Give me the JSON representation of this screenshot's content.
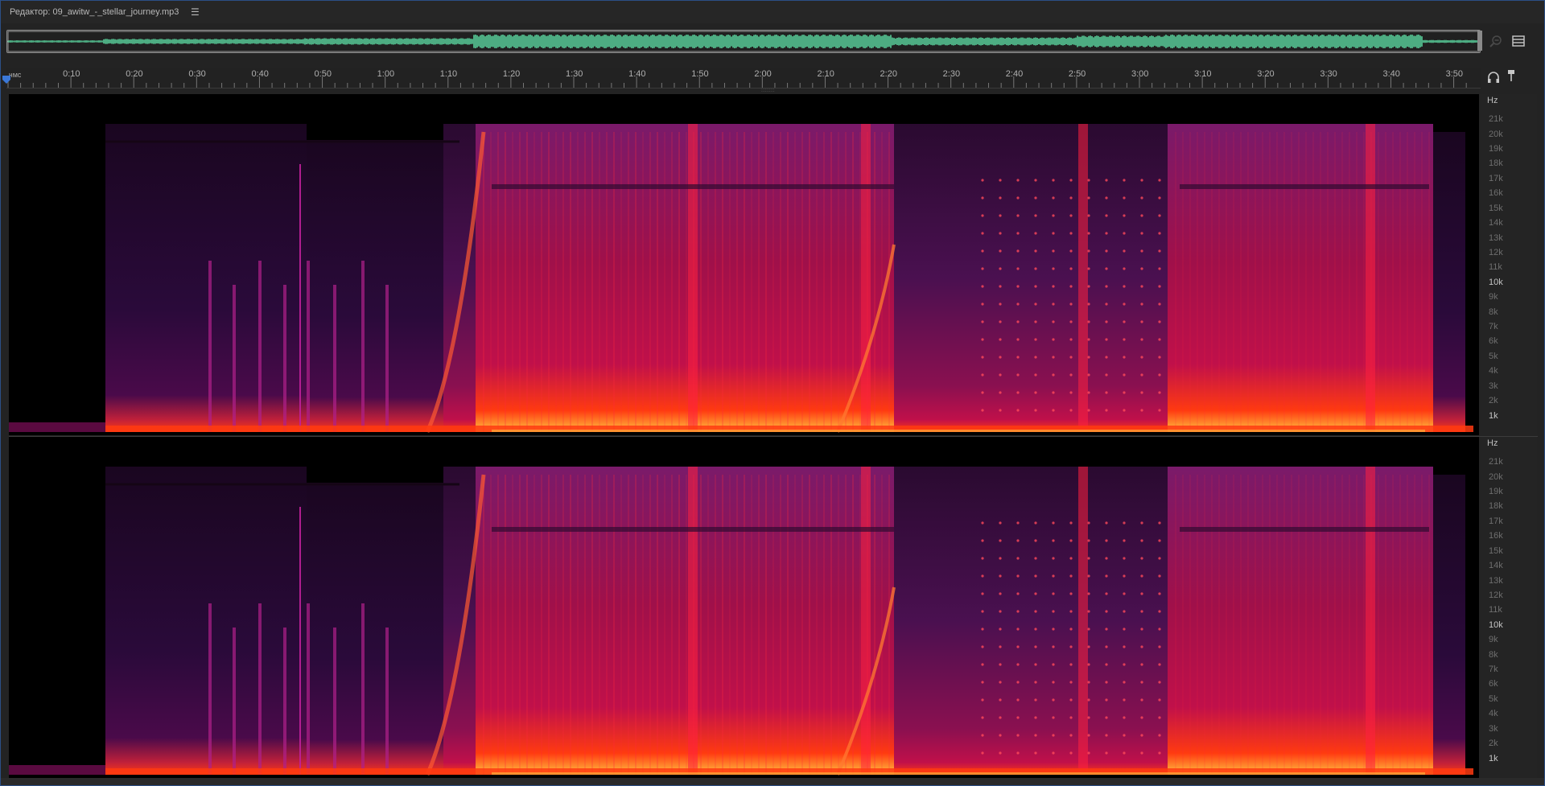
{
  "panel": {
    "title": "Редактор: 09_awitw_-_stellar_journey.mp3",
    "menu_icon": "hamburger-menu-icon"
  },
  "overview": {
    "waveform_color": "#5fe3a8",
    "viewport_border_color": "#8c8c8c"
  },
  "tools": {
    "zoom_icon": "zoom-out-icon",
    "spectral_toggle_icon": "spectral-frequency-display-icon",
    "headphones_icon": "headphones-icon",
    "pin_icon": "pin-icon"
  },
  "ruler": {
    "unit": "чмс",
    "labels": [
      "0:10",
      "0:20",
      "0:30",
      "0:40",
      "0:50",
      "1:00",
      "1:10",
      "1:20",
      "1:30",
      "1:40",
      "1:50",
      "2:00",
      "2:10",
      "2:20",
      "2:30",
      "2:40",
      "2:50",
      "3:00",
      "3:10",
      "3:20",
      "3:30",
      "3:40",
      "3:50"
    ],
    "duration_seconds": 233
  },
  "freq_axis": {
    "unit": "Hz",
    "ticks": [
      "21k",
      "20k",
      "19k",
      "18k",
      "17k",
      "16k",
      "15k",
      "14k",
      "13k",
      "12k",
      "11k",
      "10k",
      "9k",
      "8k",
      "7k",
      "6k",
      "5k",
      "4k",
      "3k",
      "2k",
      "1k"
    ],
    "major": [
      "10k",
      "1k"
    ],
    "max_hz": 21500
  },
  "channels": [
    "left",
    "right"
  ],
  "colors": {
    "accent": "#2b4f86",
    "spectrogram_low": "#2a0a3a",
    "spectrogram_mid": "#c0104a",
    "spectrogram_high": "#ff3a10",
    "spectrogram_peak": "#ffc040"
  }
}
